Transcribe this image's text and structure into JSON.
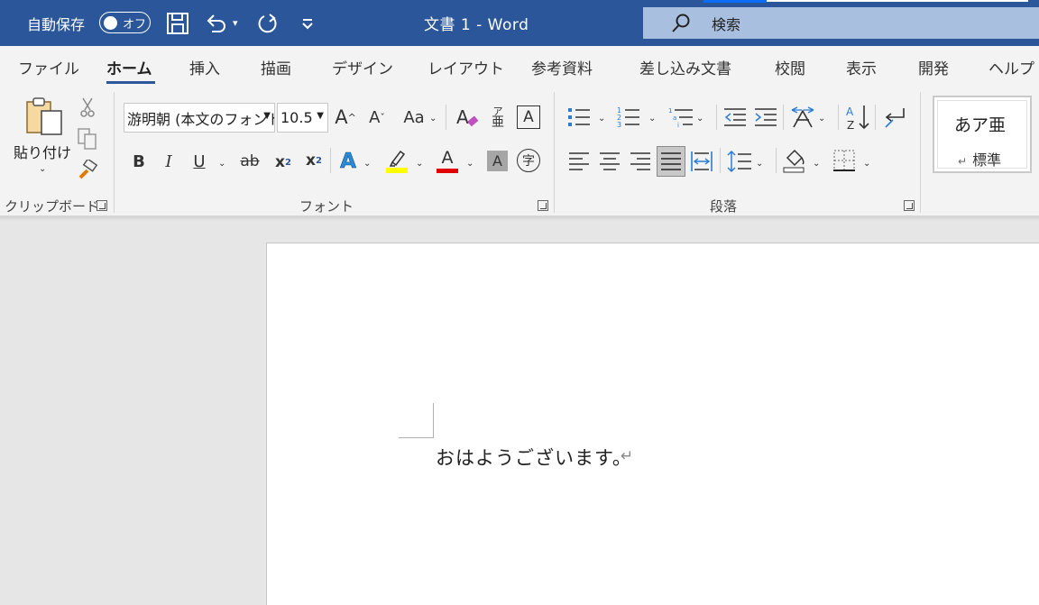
{
  "titlebar": {
    "autosave_label": "自動保存",
    "autosave_state": "オフ",
    "doc_title": "文書 1  -  Word",
    "search_label": "検索"
  },
  "tabs": [
    {
      "label": "ファイル"
    },
    {
      "label": "ホーム"
    },
    {
      "label": "挿入"
    },
    {
      "label": "描画"
    },
    {
      "label": "デザイン"
    },
    {
      "label": "レイアウト"
    },
    {
      "label": "参考資料"
    },
    {
      "label": "差し込み文書"
    },
    {
      "label": "校閲"
    },
    {
      "label": "表示"
    },
    {
      "label": "開発"
    },
    {
      "label": "ヘルプ"
    }
  ],
  "ribbon": {
    "clipboard": {
      "label": "クリップボード",
      "paste_label": "貼り付け"
    },
    "font": {
      "label": "フォント",
      "font_name": "游明朝 (本文のフォント)",
      "font_size": "10.5",
      "change_case": "Aa",
      "phonetic_top": "ア",
      "phonetic_bottom": "亜",
      "border_char": "A",
      "bold": "B",
      "italic": "I",
      "underline": "U",
      "strike": "ab",
      "sub": "x",
      "sup": "x",
      "sub_mark": "2",
      "sup_mark": "2",
      "effects": "A",
      "font_color": "A",
      "shading_char": "A",
      "enclose_char": "字",
      "grow": "A",
      "shrink": "A"
    },
    "paragraph": {
      "label": "段落"
    },
    "styles": {
      "sample": "あア亜",
      "name": "標準"
    }
  },
  "document": {
    "text": "おはようございます。",
    "paragraph_mark": "↵"
  },
  "colors": {
    "title_bar": "#2b579a",
    "highlight": "#ffff00",
    "font_color": "#e00000"
  }
}
